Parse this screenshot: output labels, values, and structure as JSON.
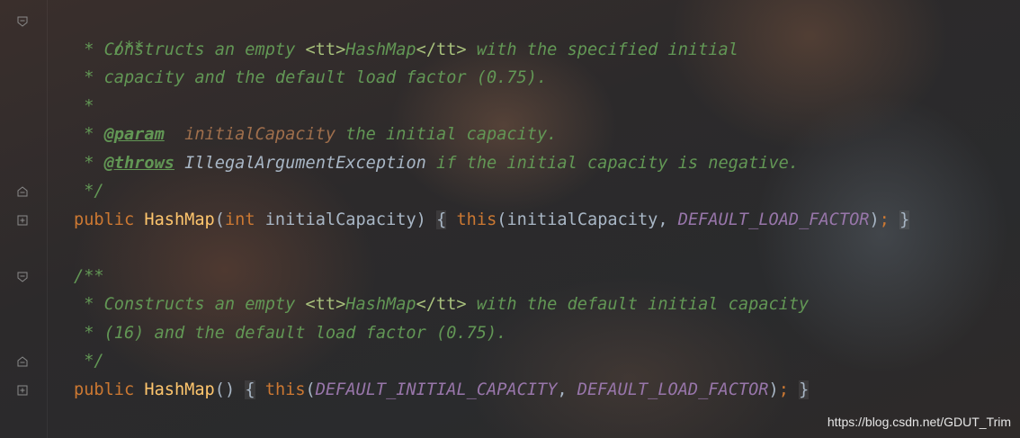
{
  "comment1": {
    "line1": "/**",
    "line2_prefix": " * Constructs an empty ",
    "line2_tt_open": "<tt>",
    "line2_name": "HashMap",
    "line2_tt_close": "</tt>",
    "line2_suffix": " with the specified initial",
    "line3": " * capacity and the default load factor (0.75).",
    "line4": " *",
    "param_prefix": " * ",
    "param_tag": "@param",
    "param_gap": "  ",
    "param_name": "initialCapacity",
    "param_desc": " the initial capacity.",
    "throws_prefix": " * ",
    "throws_tag": "@throws",
    "throws_gap": " ",
    "throws_type": "IllegalArgumentException",
    "throws_desc": " if the initial capacity is negative.",
    "end": " */"
  },
  "ctor1": {
    "keyword": "public",
    "name": "HashMap",
    "open_paren": "(",
    "param_type": "int",
    "param_name": " initialCapacity",
    "close_paren": ")",
    "brace_open": "{",
    "this_kw": "this",
    "args_open": "(initialCapacity, ",
    "const": "DEFAULT_LOAD_FACTOR",
    "args_close": ")",
    "semi": ";",
    "brace_close": "}"
  },
  "comment2": {
    "line1": "/**",
    "line2_prefix": " * Constructs an empty ",
    "line2_tt_open": "<tt>",
    "line2_name": "HashMap",
    "line2_tt_close": "</tt>",
    "line2_suffix": " with the default initial capacity",
    "line3": " * (16) and the default load factor (0.75).",
    "end": " */"
  },
  "ctor2": {
    "keyword": "public",
    "name": "HashMap",
    "parens": "()",
    "brace_open": "{",
    "this_kw": "this",
    "args_open": "(",
    "const1": "DEFAULT_INITIAL_CAPACITY",
    "sep": ", ",
    "const2": "DEFAULT_LOAD_FACTOR",
    "args_close": ")",
    "semi": ";",
    "brace_close": "}"
  },
  "watermark": "https://blog.csdn.net/GDUT_Trim",
  "colors": {
    "doc_comment": "#629755",
    "keyword": "#cc7832",
    "method": "#ffc66d",
    "constant": "#9876aa",
    "text": "#a9b7c6"
  }
}
